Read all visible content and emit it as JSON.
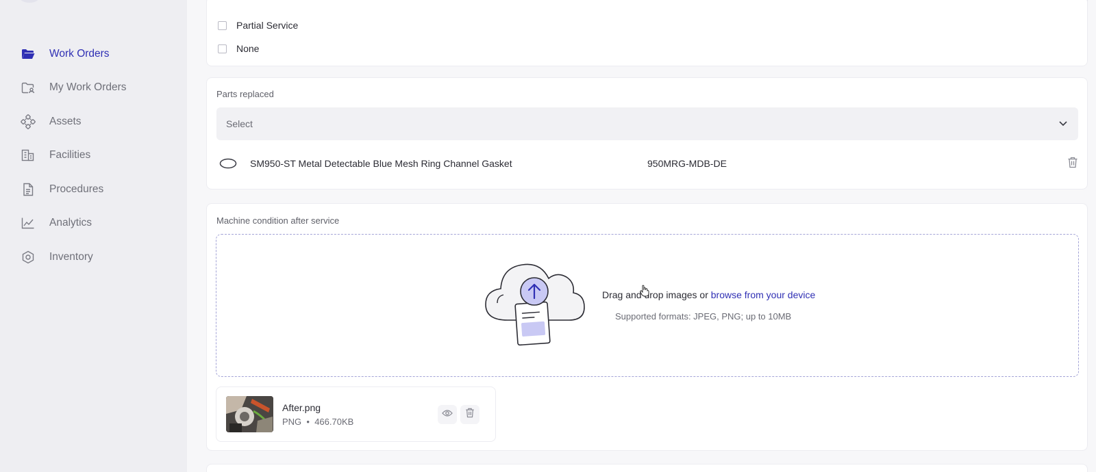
{
  "sidebar": {
    "items": [
      {
        "label": "Work Orders",
        "icon": "folder-open-icon",
        "active": true
      },
      {
        "label": "My Work Orders",
        "icon": "folder-user-icon",
        "active": false
      },
      {
        "label": "Assets",
        "icon": "assets-nodes-icon",
        "active": false
      },
      {
        "label": "Facilities",
        "icon": "building-icon",
        "active": false
      },
      {
        "label": "Procedures",
        "icon": "document-icon",
        "active": false
      },
      {
        "label": "Analytics",
        "icon": "chart-line-icon",
        "active": false
      },
      {
        "label": "Inventory",
        "icon": "hexagon-nut-icon",
        "active": false
      }
    ]
  },
  "service_options": {
    "items": [
      {
        "label": "Partial Service",
        "checked": false
      },
      {
        "label": "None",
        "checked": false
      }
    ]
  },
  "parts": {
    "label": "Parts replaced",
    "select_placeholder": "Select",
    "rows": [
      {
        "name": "SM950-ST Metal Detectable Blue Mesh Ring Channel Gasket",
        "code": "950MRG-MDB-DE"
      }
    ]
  },
  "condition": {
    "label": "Machine condition after service",
    "drop_text": "Drag and drop images or ",
    "browse_link": "browse from your device",
    "supported": "Supported formats: JPEG, PNG; up to 10MB"
  },
  "uploaded_file": {
    "name": "After.png",
    "type": "PNG",
    "separator": "•",
    "size": "466.70KB"
  },
  "colors": {
    "accent": "#2f2fb4",
    "sidebar_bg": "#eeeef2",
    "dropzone_border": "#a3a3d6"
  }
}
